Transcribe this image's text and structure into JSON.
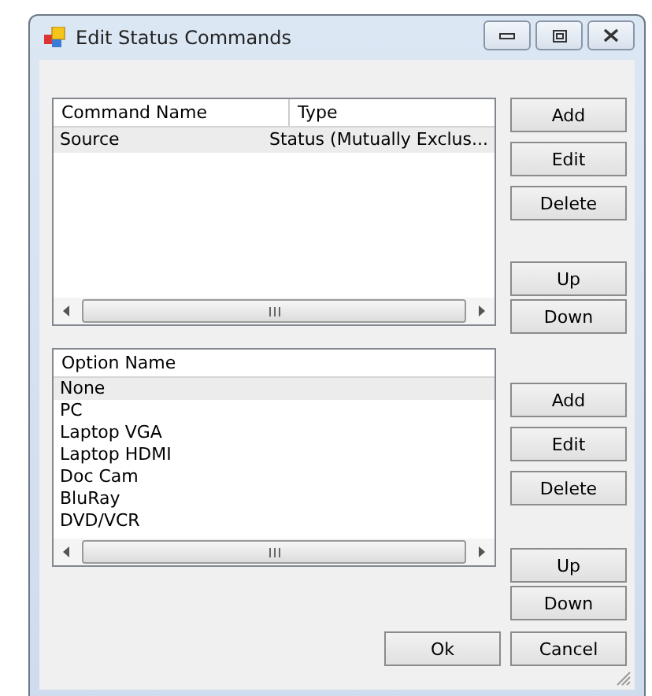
{
  "window": {
    "title": "Edit Status Commands"
  },
  "commands": {
    "columns": [
      "Command Name",
      "Type"
    ],
    "rows": [
      {
        "cells": [
          "Source",
          "Status (Mutually Exclus..."
        ],
        "selected": true
      }
    ],
    "buttons": [
      "Add",
      "Edit",
      "Delete"
    ],
    "order_buttons": [
      "Up",
      "Down"
    ]
  },
  "options": {
    "columns": [
      "Option Name"
    ],
    "rows": [
      {
        "cells": [
          "None"
        ],
        "selected": true
      },
      {
        "cells": [
          "PC"
        ],
        "selected": false
      },
      {
        "cells": [
          "Laptop VGA"
        ],
        "selected": false
      },
      {
        "cells": [
          "Laptop HDMI"
        ],
        "selected": false
      },
      {
        "cells": [
          "Doc Cam"
        ],
        "selected": false
      },
      {
        "cells": [
          "BluRay"
        ],
        "selected": false
      },
      {
        "cells": [
          "DVD/VCR"
        ],
        "selected": false
      }
    ],
    "buttons": [
      "Add",
      "Edit",
      "Delete"
    ],
    "order_buttons": [
      "Up",
      "Down"
    ]
  },
  "footer_buttons": [
    "Ok",
    "Cancel"
  ]
}
